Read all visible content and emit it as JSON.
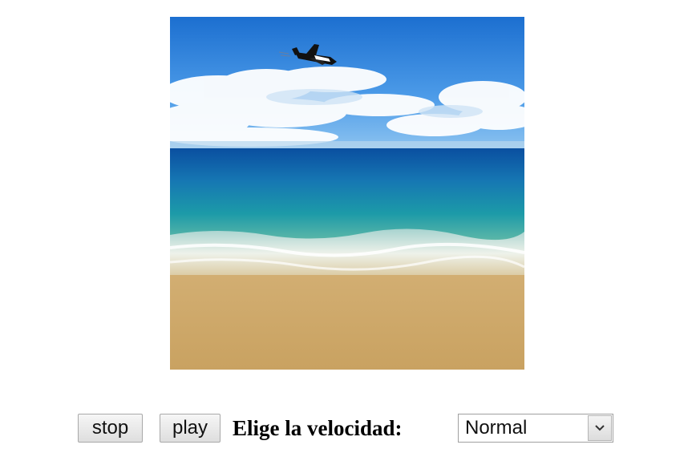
{
  "scene": {
    "image_description_icon": "beach-scene-with-airplane"
  },
  "controls": {
    "stop_label": "stop",
    "play_label": "play",
    "speed_label": "Elige la velocidad:",
    "speed_selected": "Normal"
  }
}
